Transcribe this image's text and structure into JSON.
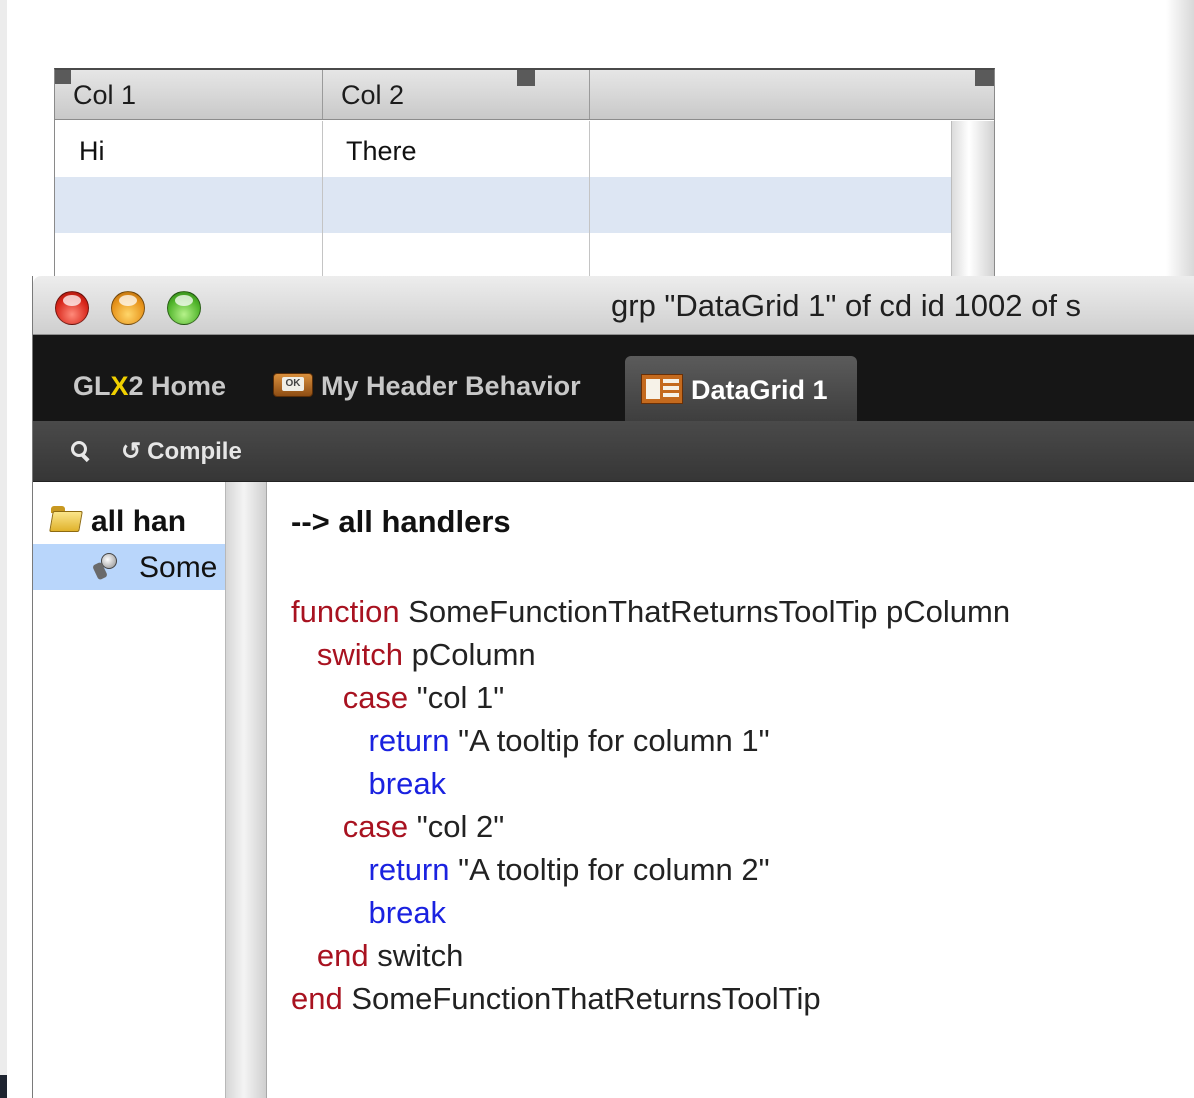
{
  "grid": {
    "columns": [
      "Col 1",
      "Col 2",
      ""
    ],
    "rows": [
      [
        "Hi",
        "There",
        ""
      ],
      [
        "",
        "",
        ""
      ],
      [
        "",
        "",
        ""
      ]
    ]
  },
  "window": {
    "title": "grp \"DataGrid 1\" of cd id 1002 of s"
  },
  "tabs": {
    "home_prefix": "GL",
    "home_x": "X",
    "home_suffix": "2 Home",
    "header_behavior": "My Header Behavior",
    "datagrid": "DataGrid 1"
  },
  "toolbar": {
    "compile_label": "Compile"
  },
  "handler_list": {
    "group_label": "all han",
    "item_label": "Some"
  },
  "editor": {
    "heading": "--> all handlers",
    "code": [
      [
        {
          "t": "function",
          "c": "red"
        },
        {
          "t": " SomeFunctionThatReturnsToolTip pColumn",
          "c": "plain"
        }
      ],
      [
        {
          "t": "   "
        },
        {
          "t": "switch",
          "c": "red"
        },
        {
          "t": " pColumn",
          "c": "plain"
        }
      ],
      [
        {
          "t": "      "
        },
        {
          "t": "case",
          "c": "red"
        },
        {
          "t": " \"col 1\"",
          "c": "plain"
        }
      ],
      [
        {
          "t": "         "
        },
        {
          "t": "return",
          "c": "blue"
        },
        {
          "t": " \"A tooltip for column 1\"",
          "c": "plain"
        }
      ],
      [
        {
          "t": "         "
        },
        {
          "t": "break",
          "c": "blue"
        }
      ],
      [
        {
          "t": "      "
        },
        {
          "t": "case",
          "c": "red"
        },
        {
          "t": " \"col 2\"",
          "c": "plain"
        }
      ],
      [
        {
          "t": "         "
        },
        {
          "t": "return",
          "c": "blue"
        },
        {
          "t": " \"A tooltip for column 2\"",
          "c": "plain"
        }
      ],
      [
        {
          "t": "         "
        },
        {
          "t": "break",
          "c": "blue"
        }
      ],
      [
        {
          "t": "   "
        },
        {
          "t": "end",
          "c": "red"
        },
        {
          "t": " switch",
          "c": "plain"
        }
      ],
      [
        {
          "t": "end",
          "c": "red"
        },
        {
          "t": " SomeFunctionThatReturnsToolTip",
          "c": "plain"
        }
      ]
    ]
  },
  "colors": {
    "keyword_red": "#a81220",
    "keyword_blue": "#1a22e0",
    "selection": "#b9d6fb",
    "alt_row": "#dde6f3"
  }
}
